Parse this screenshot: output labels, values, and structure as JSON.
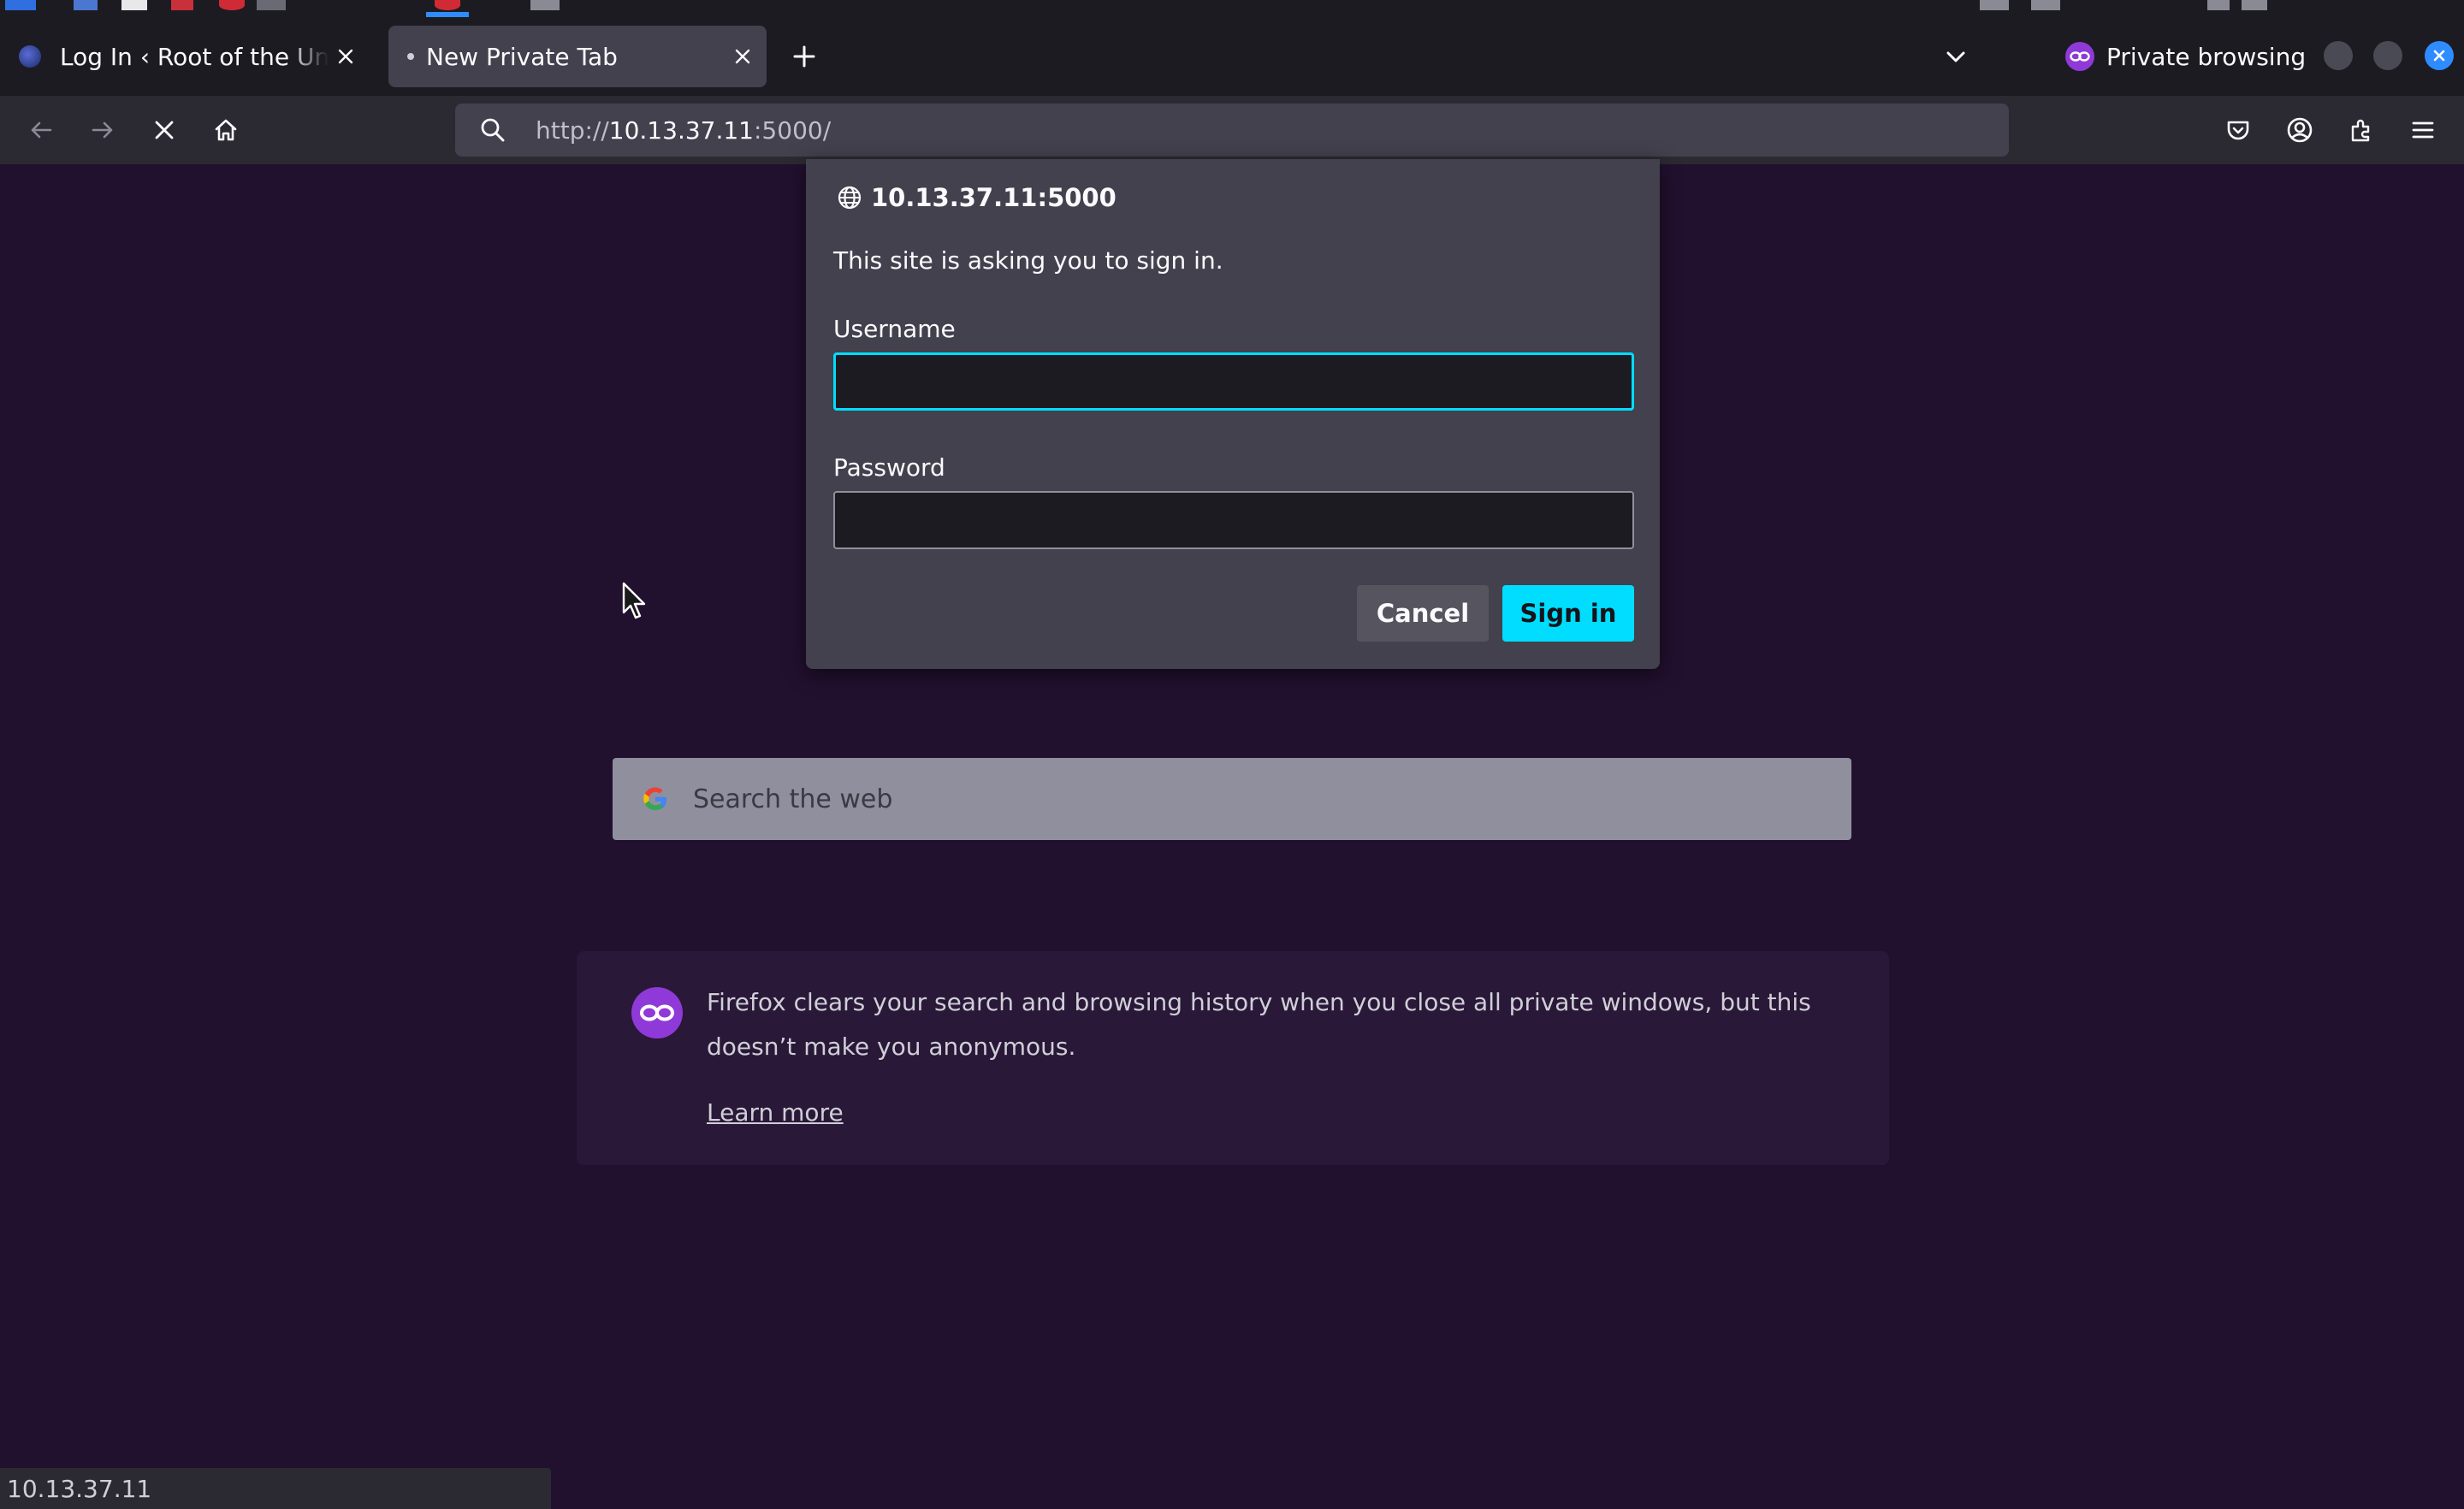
{
  "tabs": [
    {
      "title": "Log In ‹ Root of the Universe",
      "active": false
    },
    {
      "title": "New Private Tab",
      "active": true
    }
  ],
  "private_browsing": {
    "label": "Private browsing"
  },
  "navbar": {
    "url_scheme": "http://",
    "url_host": "10.13.37.11",
    "url_rest": ":5000/"
  },
  "auth_dialog": {
    "site": "10.13.37.11:5000",
    "message": "This site is asking you to sign in.",
    "username_label": "Username",
    "username_value": "",
    "password_label": "Password",
    "password_value": "",
    "cancel_label": "Cancel",
    "signin_label": "Sign in"
  },
  "search": {
    "placeholder": "Search the web"
  },
  "private_notice": {
    "message": "Firefox clears your search and browsing history when you close all private windows, but this doesn’t make you anonymous.",
    "learn_more": "Learn more"
  },
  "status_bar": {
    "text": "10.13.37.11"
  },
  "colors": {
    "page_bg": "#22102f",
    "accent": "#00ddff",
    "private_purple": "#8f3ad8",
    "toolbar": "#2b2a33"
  }
}
